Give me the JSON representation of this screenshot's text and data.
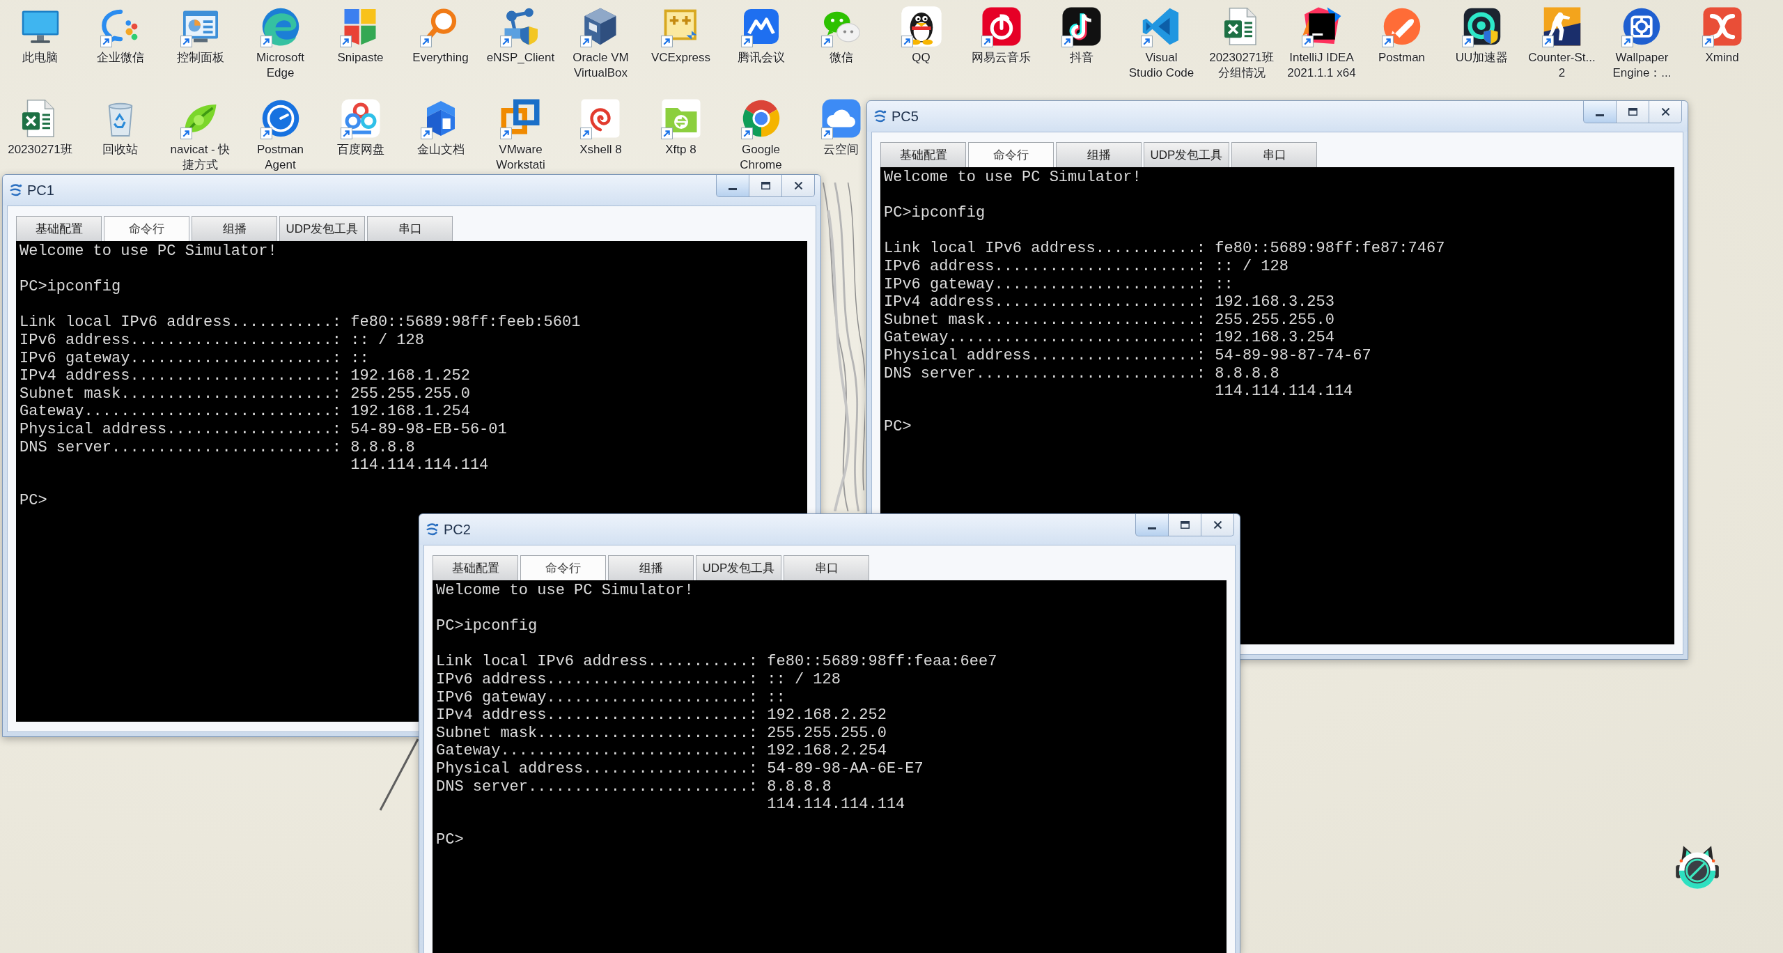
{
  "desktop_icons": [
    {
      "label": "此电脑",
      "kind": "monitor",
      "shortcut": false
    },
    {
      "label": "企业微信",
      "kind": "chat",
      "shortcut": true
    },
    {
      "label": "控制面板",
      "kind": "dashboard",
      "shortcut": true
    },
    {
      "label": "Microsoft\nEdge",
      "kind": "swirl",
      "shortcut": true
    },
    {
      "label": "Snipaste",
      "kind": "tiles",
      "shortcut": true
    },
    {
      "label": "Everything",
      "kind": "magnifier",
      "shortcut": true
    },
    {
      "label": "eNSP_Client",
      "kind": "network",
      "shortcut": true
    },
    {
      "label": "Oracle VM\nVirtualBox",
      "kind": "cube",
      "shortcut": true
    },
    {
      "label": "VCExpress",
      "kind": "plusframe",
      "shortcut": true
    },
    {
      "label": "腾讯会议",
      "kind": "meeting",
      "shortcut": true
    },
    {
      "label": "微信",
      "kind": "bubbles",
      "shortcut": true
    },
    {
      "label": "QQ",
      "kind": "penguin",
      "shortcut": true
    },
    {
      "label": "网易云音乐",
      "kind": "music",
      "shortcut": true
    },
    {
      "label": "抖音",
      "kind": "note",
      "shortcut": true
    },
    {
      "label": "Visual\nStudio Code",
      "kind": "ribbon",
      "shortcut": true
    },
    {
      "label": "20230271班分组情况",
      "kind": "sheet",
      "shortcut": false
    },
    {
      "label": "IntelliJ IDEA\n2021.1.1 x64",
      "kind": "ide",
      "shortcut": true
    },
    {
      "label": "Postman",
      "kind": "rocket",
      "shortcut": true
    },
    {
      "label": "UU加速器",
      "kind": "ring",
      "shortcut": true
    },
    {
      "label": "Counter-St...\n2",
      "kind": "soldier",
      "shortcut": true
    },
    {
      "label": "Wallpaper\nEngine：...",
      "kind": "gear",
      "shortcut": true
    },
    {
      "label": "Xmind",
      "kind": "xshape",
      "shortcut": true
    },
    {
      "label": "20230271班",
      "kind": "sheet",
      "shortcut": false
    },
    {
      "label": "回收站",
      "kind": "bin",
      "shortcut": false
    },
    {
      "label": "navicat - 快捷方式",
      "kind": "leaf",
      "shortcut": true
    },
    {
      "label": "Postman\nAgent",
      "kind": "agent",
      "shortcut": true
    },
    {
      "label": "百度网盘",
      "kind": "cloudloop",
      "shortcut": true
    },
    {
      "label": "金山文档",
      "kind": "block",
      "shortcut": true
    },
    {
      "label": "VMware\nWorkstati",
      "kind": "squares",
      "shortcut": true
    },
    {
      "label": "Xshell 8",
      "kind": "spiral",
      "shortcut": true
    },
    {
      "label": "Xftp 8",
      "kind": "folder",
      "shortcut": true
    },
    {
      "label": "Google\nChrome",
      "kind": "orb",
      "shortcut": true
    },
    {
      "label": "云空间",
      "kind": "cloud",
      "shortcut": true
    }
  ],
  "windows": [
    {
      "title": "PC1",
      "tabs": [
        {
          "label": "基础配置",
          "selected": false
        },
        {
          "label": "命令行",
          "selected": true
        },
        {
          "label": "组播",
          "selected": false
        },
        {
          "label": "UDP发包工具",
          "selected": false
        },
        {
          "label": "串口",
          "selected": false
        }
      ],
      "terminal": [
        [
          "Welcome to use PC Simulator!"
        ],
        [
          "PC>ipconfig"
        ],
        [
          "Link local IPv6 address...........: fe80::5689:98ff:feeb:5601",
          "IPv6 address......................: :: / 128",
          "IPv6 gateway......................: ::",
          "IPv4 address......................: 192.168.1.252",
          "Subnet mask.......................: 255.255.255.0",
          "Gateway...........................: 192.168.1.254",
          "Physical address..................: 54-89-98-EB-56-01",
          "DNS server........................: 8.8.8.8",
          "                                    114.114.114.114"
        ],
        [
          "PC>"
        ]
      ]
    },
    {
      "title": "PC5",
      "tabs": [
        {
          "label": "基础配置",
          "selected": false
        },
        {
          "label": "命令行",
          "selected": true
        },
        {
          "label": "组播",
          "selected": false
        },
        {
          "label": "UDP发包工具",
          "selected": false
        },
        {
          "label": "串口",
          "selected": false
        }
      ],
      "terminal": [
        [
          "Welcome to use PC Simulator!"
        ],
        [
          "PC>ipconfig"
        ],
        [
          "Link local IPv6 address...........: fe80::5689:98ff:fe87:7467",
          "IPv6 address......................: :: / 128",
          "IPv6 gateway......................: ::",
          "IPv4 address......................: 192.168.3.253",
          "Subnet mask.......................: 255.255.255.0",
          "Gateway...........................: 192.168.3.254",
          "Physical address..................: 54-89-98-87-74-67",
          "DNS server........................: 8.8.8.8",
          "                                    114.114.114.114"
        ],
        [
          "PC>"
        ]
      ]
    },
    {
      "title": "PC2",
      "tabs": [
        {
          "label": "基础配置",
          "selected": false
        },
        {
          "label": "命令行",
          "selected": true
        },
        {
          "label": "组播",
          "selected": false
        },
        {
          "label": "UDP发包工具",
          "selected": false
        },
        {
          "label": "串口",
          "selected": false
        }
      ],
      "terminal": [
        [
          "Welcome to use PC Simulator!"
        ],
        [
          "PC>ipconfig"
        ],
        [
          "Link local IPv6 address...........: fe80::5689:98ff:feaa:6ee7",
          "IPv6 address......................: :: / 128",
          "IPv6 gateway......................: ::",
          "IPv4 address......................: 192.168.2.252",
          "Subnet mask.......................: 255.255.255.0",
          "Gateway...........................: 192.168.2.254",
          "Physical address..................: 54-89-98-AA-6E-E7",
          "DNS server........................: 8.8.8.8",
          "                                    114.114.114.114"
        ],
        [
          "PC>"
        ]
      ]
    }
  ]
}
